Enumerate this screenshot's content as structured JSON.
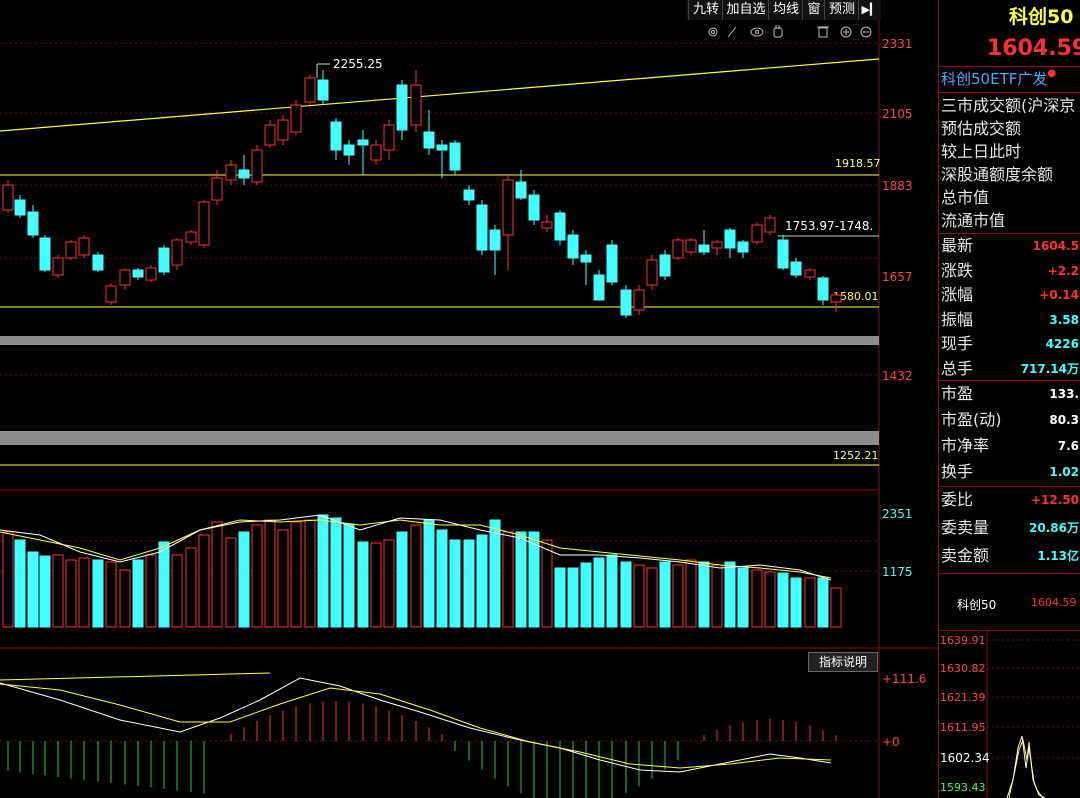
{
  "toolbar": {
    "buttons": [
      "九转",
      "加自选",
      "均线",
      "窗",
      "预测"
    ],
    "pin_icon": "collapse-panel-icon",
    "tool_icons": [
      "settings-icon",
      "pen-icon",
      "eye-icon",
      "hand-icon",
      "trash-icon",
      "zoom-in-icon",
      "zoom-out-icon"
    ]
  },
  "price_axis": {
    "ticks": [
      "2331",
      "2105",
      "1883",
      "1657",
      "1432"
    ]
  },
  "volume_axis": {
    "ticks": [
      "2351",
      "1175"
    ]
  },
  "macd_axis": {
    "ticks": [
      "+111.6",
      "+0"
    ]
  },
  "annotations": {
    "high": "2255.25",
    "lines": [
      "1918.57",
      "1753.97-1748.",
      "1580.01",
      "1252.21"
    ]
  },
  "indicator_button": "指标说明",
  "quote": {
    "name": "科创50",
    "price": "1604.59",
    "etf_link": "科创50ETF广发",
    "info_rows": [
      "三市成交额(沪深京",
      "预估成交额",
      "较上日此时",
      "深股通额度余额",
      "总市值",
      "流通市值"
    ],
    "stats": [
      {
        "label": "最新",
        "value": "1604.5"
      },
      {
        "label": "涨跌",
        "value": "+2.2"
      },
      {
        "label": "涨幅",
        "value": "+0.14"
      },
      {
        "label": "振幅",
        "value": "3.58"
      },
      {
        "label": "现手",
        "value": "4226"
      },
      {
        "label": "总手",
        "value": "717.14万"
      }
    ],
    "valuation": [
      {
        "label": "市盈",
        "value": "133."
      },
      {
        "label": "市盈(动)",
        "value": "80.3"
      },
      {
        "label": "市净率",
        "value": "7.6"
      },
      {
        "label": "换手",
        "value": "1.02"
      }
    ],
    "orders": [
      {
        "label": "委比",
        "value": "+12.50"
      },
      {
        "label": "委卖量",
        "value": "20.86万"
      },
      {
        "label": "卖金额",
        "value": "1.13亿"
      }
    ],
    "mini_label": "科创50",
    "mini_value": "1604.59",
    "mini_ticks": [
      "1639.91",
      "1630.82",
      "1621.39",
      "1611.95",
      "1602.34",
      "1593.43"
    ]
  },
  "colors": {
    "up": "#ff3030",
    "down": "#44ffff",
    "line": "#ffff44",
    "accent": "#ffd700"
  }
}
